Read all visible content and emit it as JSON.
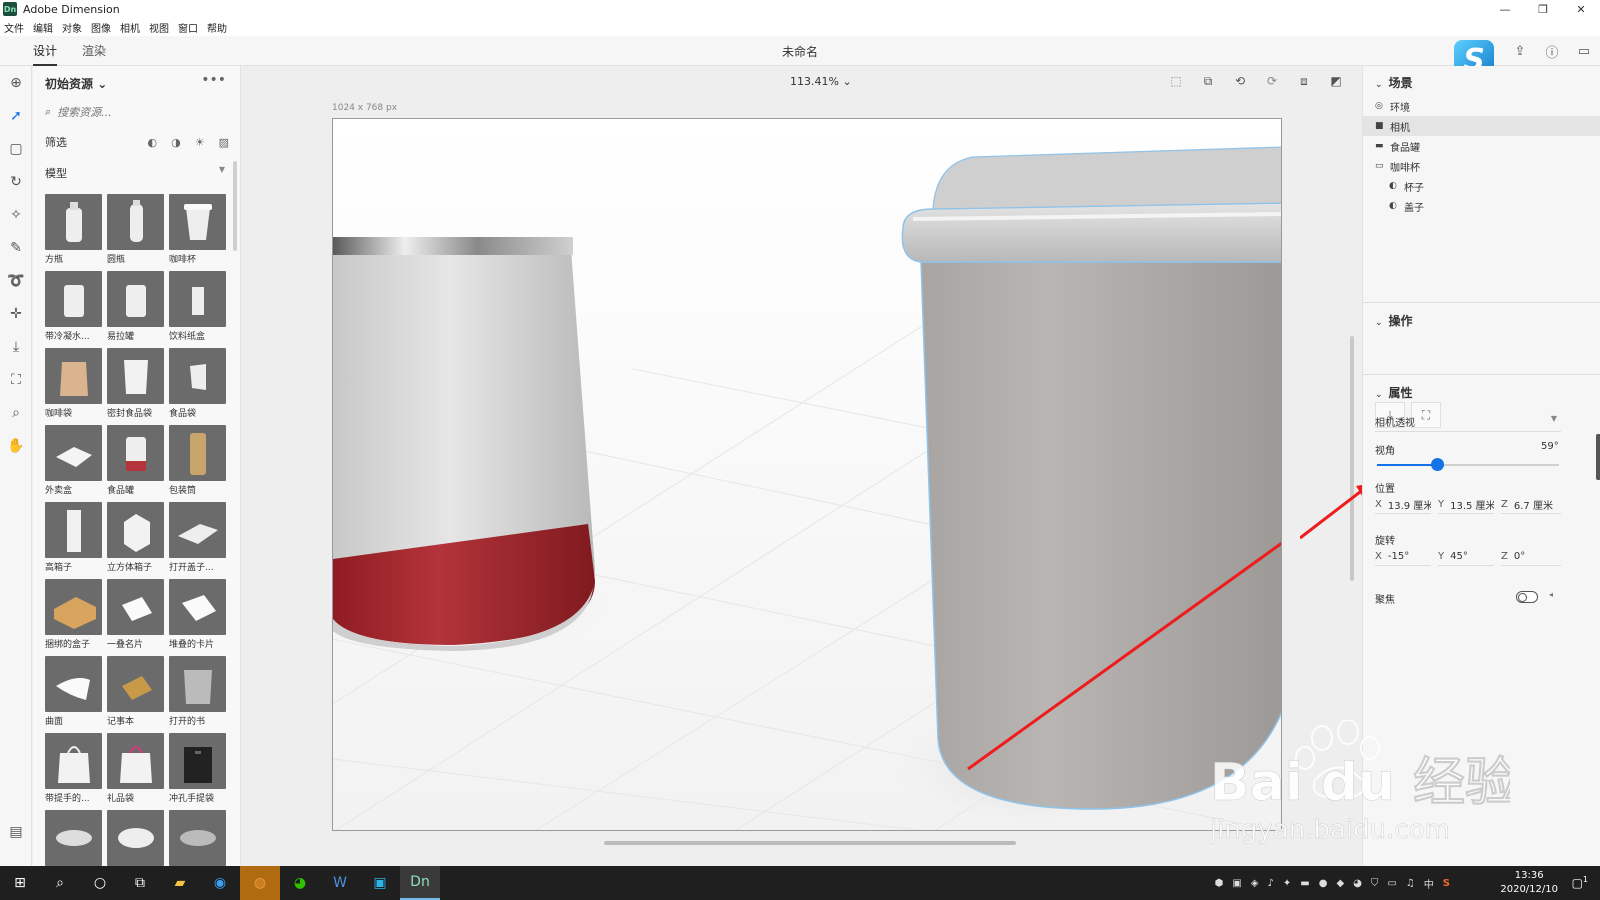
{
  "window": {
    "app_icon_text": "Dn",
    "title": "Adobe Dimension",
    "controls": [
      "—",
      "❐",
      "✕"
    ]
  },
  "menu": [
    "文件",
    "编辑",
    "对象",
    "图像",
    "相机",
    "视图",
    "窗口",
    "帮助"
  ],
  "tabs": [
    {
      "label": "设计",
      "active": true
    },
    {
      "label": "渲染",
      "active": false
    }
  ],
  "document_title": "未命名",
  "header_icons": [
    "share-icon",
    "help-icon",
    "chat-icon"
  ],
  "tools": [
    "add",
    "select",
    "frame",
    "orbit",
    "magic-wand",
    "eyedropper",
    "lasso",
    "move",
    "drop-to-ground",
    "perspective",
    "zoom",
    "hand"
  ],
  "assets": {
    "title": "初始资源",
    "title_chevron": "⌄",
    "more": "•••",
    "search_placeholder": "搜索资源...",
    "filter_label": "筛选",
    "category": "模型",
    "items": [
      {
        "label": "方瓶",
        "shape": "bottle"
      },
      {
        "label": "圆瓶",
        "shape": "tall-bottle"
      },
      {
        "label": "咖啡杯",
        "shape": "cup"
      },
      {
        "label": "带冷凝水...",
        "shape": "can"
      },
      {
        "label": "易拉罐",
        "shape": "can"
      },
      {
        "label": "饮料纸盒",
        "shape": "small-box"
      },
      {
        "label": "咖啡袋",
        "shape": "bag"
      },
      {
        "label": "密封食品袋",
        "shape": "pouch"
      },
      {
        "label": "食品袋",
        "shape": "small-pouch"
      },
      {
        "label": "外卖盒",
        "shape": "takeout"
      },
      {
        "label": "食品罐",
        "shape": "red-can"
      },
      {
        "label": "包装筒",
        "shape": "tube"
      },
      {
        "label": "高箱子",
        "shape": "tall-box"
      },
      {
        "label": "立方体箱子",
        "shape": "cube"
      },
      {
        "label": "打开盖子...",
        "shape": "open-box"
      },
      {
        "label": "捆绑的盒子",
        "shape": "parcel"
      },
      {
        "label": "一叠名片",
        "shape": "cards"
      },
      {
        "label": "堆叠的卡片",
        "shape": "stack"
      },
      {
        "label": "曲面",
        "shape": "sheet"
      },
      {
        "label": "记事本",
        "shape": "notebook"
      },
      {
        "label": "打开的书",
        "shape": "book"
      },
      {
        "label": "带提手的...",
        "shape": "shopping-bag"
      },
      {
        "label": "礼品袋",
        "shape": "gift-bag"
      },
      {
        "label": "冲孔手提袋",
        "shape": "black-bag"
      },
      {
        "label": "",
        "shape": "jar"
      },
      {
        "label": "",
        "shape": "bowl"
      },
      {
        "label": "",
        "shape": "lid"
      }
    ]
  },
  "viewport": {
    "zoom": "113.41%",
    "zoom_chevron": "⌄",
    "canvas_size": "1024 x 768 px"
  },
  "scene_panel": {
    "title": "场景",
    "items": [
      {
        "label": "环境",
        "icon": "◎",
        "indent": 0,
        "selected": false
      },
      {
        "label": "相机",
        "icon": "■",
        "indent": 0,
        "selected": true
      },
      {
        "label": "食品罐",
        "icon": "▬",
        "indent": 0,
        "selected": false
      },
      {
        "label": "咖啡杯",
        "icon": "▭",
        "indent": 0,
        "selected": false
      },
      {
        "label": "杯子",
        "icon": "◐",
        "indent": 1,
        "selected": false
      },
      {
        "label": "盖子",
        "icon": "◐",
        "indent": 1,
        "selected": false
      }
    ]
  },
  "actions_panel": {
    "title": "操作"
  },
  "properties_panel": {
    "title": "属性",
    "camera_mode": "相机透视",
    "fov_label": "视角",
    "fov_value": "59°",
    "fov_fraction": 0.33,
    "position_label": "位置",
    "position": {
      "x": "13.9 厘米",
      "y": "13.5 厘米",
      "z": "6.7 厘米"
    },
    "rotation_label": "旋转",
    "rotation": {
      "x": "-15°",
      "y": "45°",
      "z": "0°"
    },
    "focus_label": "聚焦",
    "focus_on": false
  },
  "taskbar": {
    "time": "13:36",
    "date": "2020/12/10",
    "ime": "中",
    "notification_count": "1"
  },
  "watermark": {
    "brand": "Bai du 经验",
    "url": "jingyan.baidu.com"
  },
  "colors": {
    "accent": "#1473e6",
    "can_red": "#a0242b",
    "arrow": "#ee1c1c",
    "taskbar": "#1f1f1f"
  }
}
